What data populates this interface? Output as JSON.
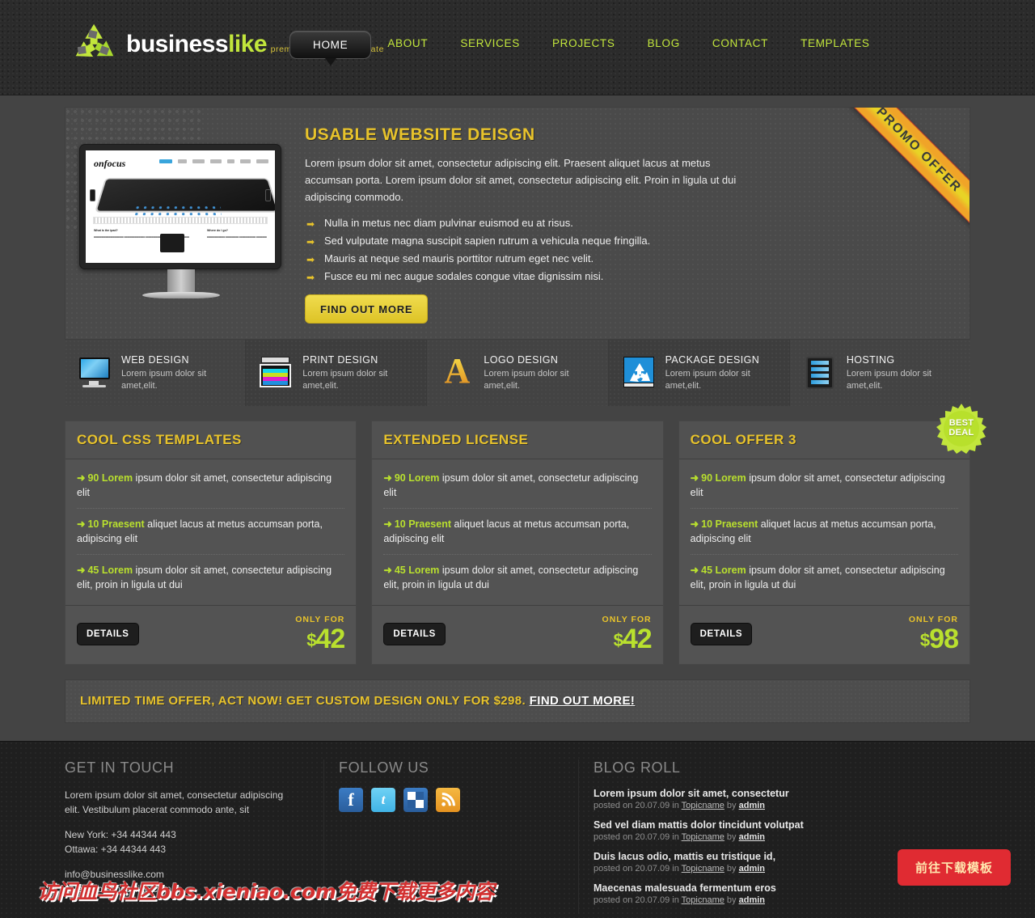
{
  "brand": {
    "name_part1": "business",
    "name_part2": "like",
    "tagline": "premium html/css template",
    "logo_icon": "recycle-icon",
    "accent_green": "#c2e63c",
    "accent_yellow": "#e8c32b"
  },
  "nav": {
    "items": [
      {
        "label": "HOME",
        "active": true
      },
      {
        "label": "ABOUT",
        "active": false
      },
      {
        "label": "SERVICES",
        "active": false
      },
      {
        "label": "PROJECTS",
        "active": false
      },
      {
        "label": "BLOG",
        "active": false
      },
      {
        "label": "CONTACT",
        "active": false
      },
      {
        "label": "TEMPLATES",
        "active": false
      }
    ]
  },
  "hero": {
    "ribbon": "PROMO OFFER",
    "title": "USABLE WEBSITE DEISGN",
    "paragraph": "Lorem ipsum dolor sit amet, consectetur adipiscing elit. Praesent aliquet lacus at metus accumsan porta. Lorem ipsum dolor sit amet, consectetur adipiscing elit. Proin in ligula ut dui adipiscing commodo.",
    "bullets": [
      "Nulla in metus nec diam pulvinar euismod eu at risus.",
      "Sed vulputate magna suscipit sapien rutrum a vehicula neque fringilla.",
      "Mauris at neque sed mauris porttitor rutrum eget nec velit.",
      "Fusce eu mi nec augue sodales congue vitae dignissim nisi."
    ],
    "bullet_icon": "arrow-right-icon",
    "button": "FIND OUT MORE",
    "screenshot": {
      "brand": "onfocus",
      "col_a_heading": "What is the ipad?",
      "col_b_heading": "Where do I go?"
    }
  },
  "services": [
    {
      "icon": "monitor-icon",
      "title": "WEB DESIGN",
      "desc": "Lorem ipsum dolor sit amet,elit."
    },
    {
      "icon": "printer-icon",
      "title": "PRINT DESIGN",
      "desc": "Lorem ipsum dolor sit amet,elit."
    },
    {
      "icon": "letter-a-icon",
      "title": "LOGO DESIGN",
      "desc": "Lorem ipsum dolor sit amet,elit."
    },
    {
      "icon": "recycle-box-icon",
      "title": "PACKAGE DESIGN",
      "desc": "Lorem ipsum dolor sit amet,elit."
    },
    {
      "icon": "server-rack-icon",
      "title": "HOSTING",
      "desc": "Lorem ipsum dolor sit amet,elit."
    }
  ],
  "pricing": {
    "only_for_label": "ONLY FOR",
    "details_label": "DETAILS",
    "badge": {
      "line1": "BEST",
      "line2": "DEAL"
    },
    "boxes": [
      {
        "title": "COOL CSS TEMPLATES",
        "features": [
          {
            "hi": "90 Lorem",
            "rest": " ipsum dolor sit amet, consectetur adipiscing elit"
          },
          {
            "hi": "10 Praesent",
            "rest": " aliquet lacus at metus accumsan porta, adipiscing elit"
          },
          {
            "hi": "45 Lorem",
            "rest": " ipsum dolor sit amet, consectetur adipiscing elit, proin in ligula ut dui"
          }
        ],
        "currency": "$",
        "price": "42"
      },
      {
        "title": "EXTENDED LICENSE",
        "features": [
          {
            "hi": "90 Lorem",
            "rest": " ipsum dolor sit amet, consectetur adipiscing elit"
          },
          {
            "hi": "10 Praesent",
            "rest": " aliquet lacus at metus accumsan porta, adipiscing elit"
          },
          {
            "hi": "45 Lorem",
            "rest": " ipsum dolor sit amet, consectetur adipiscing elit, proin in ligula ut dui"
          }
        ],
        "currency": "$",
        "price": "42"
      },
      {
        "title": "COOL OFFER 3",
        "features": [
          {
            "hi": "90 Lorem",
            "rest": " ipsum dolor sit amet, consectetur adipiscing elit"
          },
          {
            "hi": "10 Praesent",
            "rest": " aliquet lacus at metus accumsan porta, adipiscing elit"
          },
          {
            "hi": "45 Lorem",
            "rest": " ipsum dolor sit amet, consectetur adipiscing elit, proin in ligula ut dui"
          }
        ],
        "currency": "$",
        "price": "98"
      }
    ]
  },
  "cta": {
    "text": "LIMITED TIME OFFER, ACT NOW! GET CUSTOM DESIGN ONLY FOR $298. ",
    "link": "FIND OUT MORE!"
  },
  "footer": {
    "contact": {
      "title": "GET IN TOUCH",
      "blurb": "Lorem ipsum dolor sit amet, consectetur adipiscing elit. Vestibulum placerat commodo ante, sit",
      "phone1": "New York: +34 44344 443",
      "phone2": "Ottawa: +34 44344 443",
      "email1": "info@businesslike.com",
      "email2": "sales@businesslike.com"
    },
    "follow": {
      "title": "FOLLOW US",
      "socials": [
        {
          "name": "facebook-icon",
          "glyph": "f"
        },
        {
          "name": "twitter-icon",
          "glyph": "t"
        },
        {
          "name": "delicious-icon",
          "glyph": ""
        },
        {
          "name": "rss-icon",
          "glyph": ""
        }
      ]
    },
    "blog": {
      "title": "BLOG ROLL",
      "posts": [
        {
          "title": "Lorem ipsum dolor sit amet, consectetur",
          "posted": "posted on 20.07.09 in ",
          "topic": "Topicname",
          "by": " by ",
          "author": "admin"
        },
        {
          "title": "Sed vel diam mattis dolor tincidunt volutpat",
          "posted": "posted on 20.07.09 in ",
          "topic": "Topicname",
          "by": " by ",
          "author": "admin"
        },
        {
          "title": "Duis lacus odio, mattis eu tristique id,",
          "posted": "posted on 20.07.09 in ",
          "topic": "Topicname",
          "by": " by ",
          "author": "admin"
        },
        {
          "title": "Maecenas malesuada fermentum eros",
          "posted": "posted on 20.07.09 in ",
          "topic": "Topicname",
          "by": " by ",
          "author": "admin"
        }
      ]
    },
    "watermark": "访问血鸟社区bbs.xieniao.com免费下载更多内容",
    "download_button": "前往下载模板"
  }
}
